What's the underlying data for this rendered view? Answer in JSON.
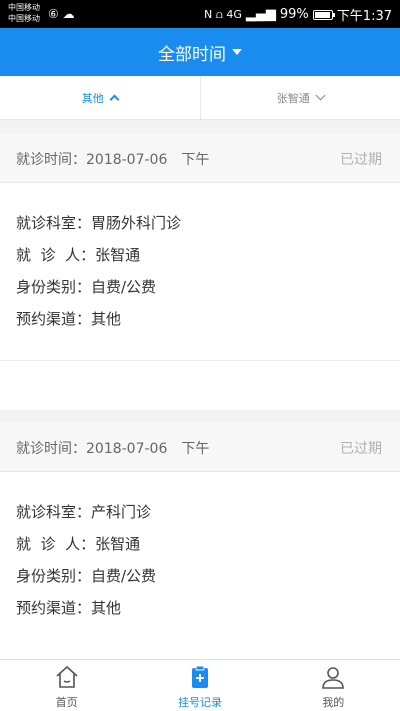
{
  "status_bar": {
    "carrier_line1": "中国移动",
    "carrier_line2": "中国移动",
    "left_icons": "⑥ ☁",
    "battery": "99%",
    "time": "下午1:37",
    "network_glyphs": "N ⩍ 4G"
  },
  "header": {
    "title": "全部时间"
  },
  "filters": {
    "type_label": "其他",
    "person_label": "张智通"
  },
  "records": [
    {
      "visit_time": "就诊时间：2018-07-06　下午",
      "status": "已过期",
      "department": "就诊科室：胃肠外科门诊",
      "patient": "就  诊  人：张智通",
      "identity": "身份类别：自费/公费",
      "channel": "预约渠道：其他"
    },
    {
      "visit_time": "就诊时间：2018-07-06　下午",
      "status": "已过期",
      "department": "就诊科室：产科门诊",
      "patient": "就  诊  人：张智通",
      "identity": "身份类别：自费/公费",
      "channel": "预约渠道：其他"
    }
  ],
  "tabbar": {
    "home": "首页",
    "records": "挂号记录",
    "mine": "我的"
  },
  "colors": {
    "accent": "#1a8cf0",
    "expired": "#b0b0b0"
  }
}
